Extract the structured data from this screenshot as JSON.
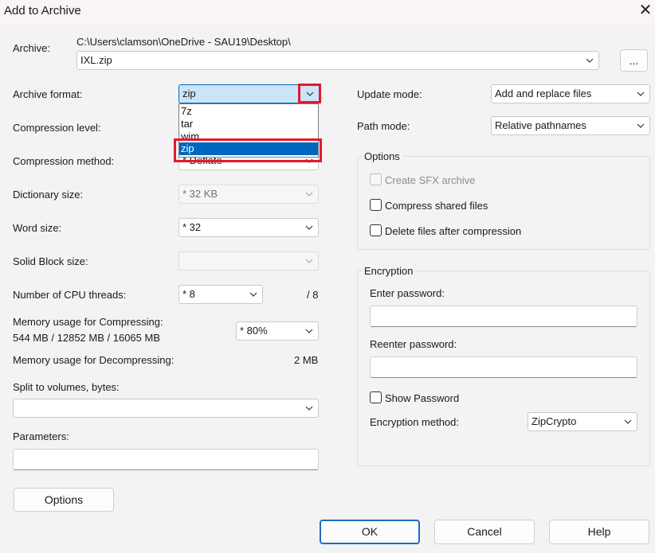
{
  "window": {
    "title": "Add to Archive",
    "close_glyph": "✕"
  },
  "archive": {
    "label": "Archive:",
    "path": "C:\\Users\\clamson\\OneDrive - SAU19\\Desktop\\",
    "filename": "IXL.zip",
    "browse_label": "..."
  },
  "left": {
    "format_label": "Archive format:",
    "format_value": "zip",
    "format_options": [
      "7z",
      "tar",
      "wim",
      "zip"
    ],
    "compression_level_label": "Compression level:",
    "compression_method_label": "Compression method:",
    "compression_method_value": "* Deflate",
    "dictionary_label": "Dictionary size:",
    "dictionary_value": "* 32 KB",
    "word_label": "Word size:",
    "word_value": "* 32",
    "solid_label": "Solid Block size:",
    "solid_value": "",
    "threads_label": "Number of CPU threads:",
    "threads_value": "* 8",
    "threads_max": "/ 8",
    "mem_comp_label": "Memory usage for Compressing:",
    "mem_comp_detail": "544 MB / 12852 MB / 16065 MB",
    "mem_comp_value": "* 80%",
    "mem_decomp_label": "Memory usage for Decompressing:",
    "mem_decomp_value": "2 MB",
    "split_label": "Split to volumes, bytes:",
    "split_value": "",
    "params_label": "Parameters:",
    "params_value": "",
    "options_button": "Options"
  },
  "right": {
    "update_label": "Update mode:",
    "update_value": "Add and replace files",
    "path_label": "Path mode:",
    "path_value": "Relative pathnames",
    "options_title": "Options",
    "sfx_label": "Create SFX archive",
    "shared_label": "Compress shared files",
    "delete_label": "Delete files after compression",
    "encryption_title": "Encryption",
    "enter_pw_label": "Enter password:",
    "reenter_pw_label": "Reenter password:",
    "show_pw_label": "Show Password",
    "enc_method_label": "Encryption method:",
    "enc_method_value": "ZipCrypto"
  },
  "buttons": {
    "ok": "OK",
    "cancel": "Cancel",
    "help": "Help"
  },
  "colors": {
    "highlight": "#0067c0",
    "annotation": "#e01a2b",
    "default_button_border": "#1f6bc4"
  }
}
